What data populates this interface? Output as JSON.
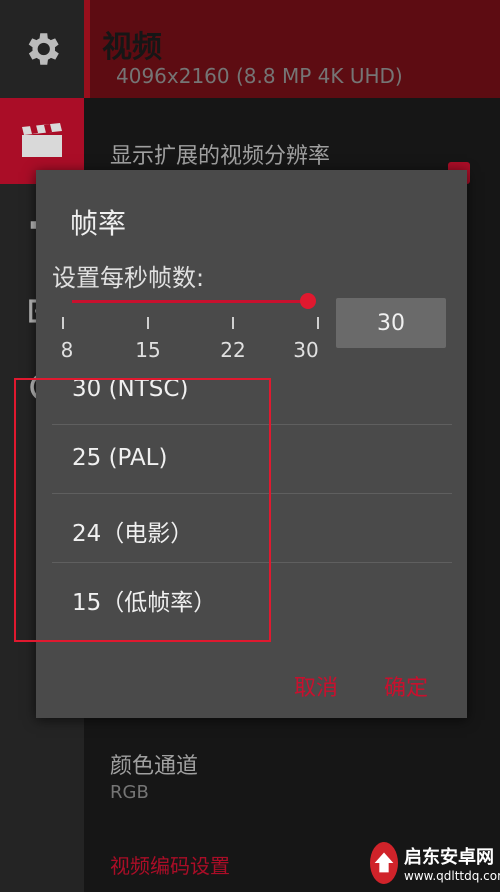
{
  "header": {
    "title": "视频",
    "clipped_text": "4096x2160 (8.8 MP 4K UHD)"
  },
  "settings": {
    "extended_resolution": "显示扩展的视频分辨率",
    "color_channel_title": "颜色通道",
    "color_channel_value": "RGB",
    "advanced_title": "视频编码设置"
  },
  "dialog": {
    "title": "帧率",
    "subtitle": "设置每秒帧数:",
    "slider": {
      "min": 8,
      "max": 30,
      "value": 30,
      "ticks": [
        "8",
        "15",
        "22",
        "30"
      ]
    },
    "value_display": "30",
    "options": [
      {
        "label": "30 (NTSC)"
      },
      {
        "label": "25 (PAL)"
      },
      {
        "label": "24（电影）"
      },
      {
        "label": "15（低帧率）"
      }
    ],
    "cancel_label": "取消",
    "ok_label": "确定"
  },
  "watermark": {
    "title": "启东安卓网",
    "url": "www.qdlttdq.com"
  },
  "colors": {
    "accent": "#c8102e",
    "dialog_bg": "#4a4a4a",
    "header_bg": "#6e0f16"
  }
}
